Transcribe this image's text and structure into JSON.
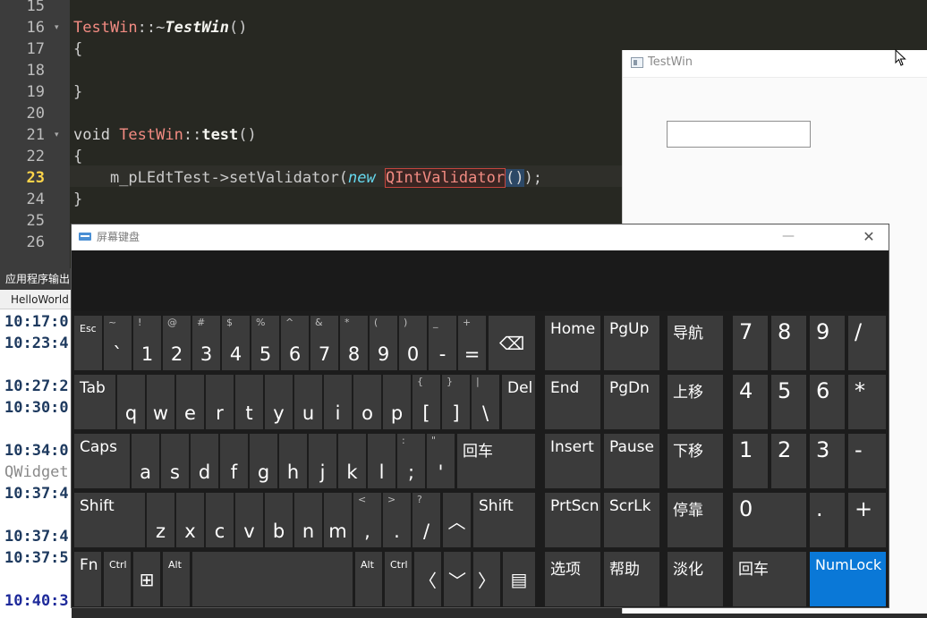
{
  "editor": {
    "lines": [
      {
        "num": "15"
      },
      {
        "num": "16",
        "fold": "▾",
        "parts": [
          {
            "t": "TestWin",
            "c": "cls"
          },
          {
            "t": "::~",
            "c": "op"
          },
          {
            "t": "TestWin",
            "c": "fnb"
          },
          {
            "t": "()",
            "c": "op"
          }
        ]
      },
      {
        "num": "17",
        "parts": [
          {
            "t": "{",
            "c": "op"
          }
        ]
      },
      {
        "num": "18"
      },
      {
        "num": "19",
        "parts": [
          {
            "t": "}",
            "c": "op"
          }
        ]
      },
      {
        "num": "20"
      },
      {
        "num": "21",
        "fold": "▾",
        "parts": [
          {
            "t": "void ",
            "c": "kw"
          },
          {
            "t": "TestWin",
            "c": "cls"
          },
          {
            "t": "::",
            "c": "op"
          },
          {
            "t": "test",
            "c": "fn"
          },
          {
            "t": "()",
            "c": "op"
          }
        ]
      },
      {
        "num": "22",
        "parts": [
          {
            "t": "{",
            "c": "op"
          }
        ]
      },
      {
        "num": "23",
        "current": true,
        "parts": [
          {
            "t": "    m_pLEdtTest->setValidator(",
            "c": "op"
          },
          {
            "t": "new",
            "c": "new"
          },
          {
            "t": " ",
            "c": "op"
          },
          {
            "t": "QIntValidator",
            "c": "hl"
          },
          {
            "t": "()",
            "c": "hlp"
          },
          {
            "t": ");",
            "c": "op"
          }
        ]
      },
      {
        "num": "24",
        "parts": [
          {
            "t": "}",
            "c": "op"
          }
        ]
      },
      {
        "num": "25"
      },
      {
        "num": "26"
      }
    ]
  },
  "output": {
    "header": "应用程序输出",
    "tab": "HelloWorld",
    "lines": [
      {
        "text": "10:17:0",
        "style": ""
      },
      {
        "text": "10:23:4",
        "style": ""
      },
      {
        "text": "10:27:2",
        "style": ""
      },
      {
        "text": "10:30:0",
        "style": ""
      },
      {
        "text": "10:34:0",
        "style": ""
      },
      {
        "text": "QWidget",
        "style": "gray"
      },
      {
        "text": "10:37:4",
        "style": ""
      },
      {
        "text": "10:37:4",
        "style": ""
      },
      {
        "text": "10:37:5",
        "style": ""
      },
      {
        "text": "10:40:3",
        "style": "blue"
      }
    ]
  },
  "testwin": {
    "title": "TestWin",
    "line_edit_value": ""
  },
  "osk": {
    "title": "屏幕键盘",
    "minimize_glyph": "—",
    "close_glyph": "✕",
    "keys": [
      {
        "name": "esc",
        "sm": "Esc"
      },
      {
        "name": "backtick",
        "sh": "~",
        "m": "`"
      },
      {
        "name": "1",
        "sh": "!",
        "m": "1"
      },
      {
        "name": "2",
        "sh": "@",
        "m": "2"
      },
      {
        "name": "3",
        "sh": "#",
        "m": "3"
      },
      {
        "name": "4",
        "sh": "$",
        "m": "4"
      },
      {
        "name": "5",
        "sh": "%",
        "m": "5"
      },
      {
        "name": "6",
        "sh": "^",
        "m": "6"
      },
      {
        "name": "7",
        "sh": "&",
        "m": "7"
      },
      {
        "name": "8",
        "sh": "*",
        "m": "8"
      },
      {
        "name": "9",
        "sh": "(",
        "m": "9"
      },
      {
        "name": "0",
        "sh": ")",
        "m": "0"
      },
      {
        "name": "minus",
        "sh": "_",
        "m": "-"
      },
      {
        "name": "equals",
        "sh": "+",
        "m": "="
      },
      {
        "name": "backspace",
        "icon": "backspace-icon",
        "glyph": "⌫"
      },
      {
        "name": "home",
        "tl": "Home"
      },
      {
        "name": "pgup",
        "tl": "PgUp"
      },
      {
        "name": "nav",
        "tl": "导航"
      },
      {
        "name": "np7",
        "tl": "7",
        "np": true
      },
      {
        "name": "np8",
        "tl": "8",
        "np": true
      },
      {
        "name": "np9",
        "tl": "9",
        "np": true
      },
      {
        "name": "npdiv",
        "tl": "/",
        "np": true
      },
      {
        "name": "tab",
        "tl": "Tab"
      },
      {
        "name": "q",
        "m": "q"
      },
      {
        "name": "w",
        "m": "w"
      },
      {
        "name": "e",
        "m": "e"
      },
      {
        "name": "r",
        "m": "r"
      },
      {
        "name": "t",
        "m": "t"
      },
      {
        "name": "y",
        "m": "y"
      },
      {
        "name": "u",
        "m": "u"
      },
      {
        "name": "i",
        "m": "i"
      },
      {
        "name": "o",
        "m": "o"
      },
      {
        "name": "p",
        "m": "p"
      },
      {
        "name": "lbracket",
        "sh": "{",
        "m": "["
      },
      {
        "name": "rbracket",
        "sh": "}",
        "m": "]"
      },
      {
        "name": "backslash",
        "sh": "|",
        "m": "\\"
      },
      {
        "name": "del",
        "tl": "Del"
      },
      {
        "name": "end",
        "tl": "End"
      },
      {
        "name": "pgdn",
        "tl": "PgDn"
      },
      {
        "name": "moveup",
        "tl": "上移"
      },
      {
        "name": "np4",
        "tl": "4",
        "np": true
      },
      {
        "name": "np5",
        "tl": "5",
        "np": true
      },
      {
        "name": "np6",
        "tl": "6",
        "np": true
      },
      {
        "name": "npmul",
        "tl": "*",
        "np": true
      },
      {
        "name": "caps",
        "tl": "Caps"
      },
      {
        "name": "a",
        "m": "a"
      },
      {
        "name": "s",
        "m": "s"
      },
      {
        "name": "d",
        "m": "d"
      },
      {
        "name": "f",
        "m": "f"
      },
      {
        "name": "g",
        "m": "g"
      },
      {
        "name": "h",
        "m": "h"
      },
      {
        "name": "j",
        "m": "j"
      },
      {
        "name": "k",
        "m": "k"
      },
      {
        "name": "l",
        "m": "l"
      },
      {
        "name": "semicolon",
        "sh": ":",
        "m": ";"
      },
      {
        "name": "quote",
        "sh": "\"",
        "m": "'"
      },
      {
        "name": "enter",
        "tl": "回车"
      },
      {
        "name": "insert",
        "tl": "Insert"
      },
      {
        "name": "pause",
        "tl": "Pause"
      },
      {
        "name": "movedown",
        "tl": "下移"
      },
      {
        "name": "np1",
        "tl": "1",
        "np": true
      },
      {
        "name": "np2",
        "tl": "2",
        "np": true
      },
      {
        "name": "np3",
        "tl": "3",
        "np": true
      },
      {
        "name": "npminus",
        "tl": "-",
        "np": true
      },
      {
        "name": "lshift",
        "tl": "Shift"
      },
      {
        "name": "z",
        "m": "z"
      },
      {
        "name": "x",
        "m": "x"
      },
      {
        "name": "c",
        "m": "c"
      },
      {
        "name": "v",
        "m": "v"
      },
      {
        "name": "b",
        "m": "b"
      },
      {
        "name": "n",
        "m": "n"
      },
      {
        "name": "m",
        "m": "m"
      },
      {
        "name": "comma",
        "sh": "<",
        "m": ","
      },
      {
        "name": "period",
        "sh": ">",
        "m": "."
      },
      {
        "name": "slash",
        "sh": "?",
        "m": "/"
      },
      {
        "name": "uparrow",
        "icon": "arrow-up-icon",
        "glyph": "︿"
      },
      {
        "name": "rshift",
        "tl": "Shift"
      },
      {
        "name": "prtscn",
        "tl": "PrtScn"
      },
      {
        "name": "scrlk",
        "tl": "ScrLk"
      },
      {
        "name": "dock",
        "tl": "停靠"
      },
      {
        "name": "np0",
        "tl": "0",
        "np": true
      },
      {
        "name": "npdot",
        "tl": ".",
        "np": true
      },
      {
        "name": "npplus",
        "tl": "+",
        "np": true
      },
      {
        "name": "fn",
        "tl": "Fn"
      },
      {
        "name": "lctrl",
        "sm": "Ctrl"
      },
      {
        "name": "win",
        "icon": "windows-logo-icon",
        "glyph": "⊞"
      },
      {
        "name": "lalt",
        "sm": "Alt"
      },
      {
        "name": "space"
      },
      {
        "name": "ralt",
        "sm": "Alt"
      },
      {
        "name": "rctrl",
        "sm": "Ctrl"
      },
      {
        "name": "leftarrow",
        "icon": "arrow-left-icon",
        "glyph": "〈"
      },
      {
        "name": "downarrow",
        "icon": "arrow-down-icon",
        "glyph": "﹀"
      },
      {
        "name": "rightarrow",
        "icon": "arrow-right-icon",
        "glyph": "〉"
      },
      {
        "name": "menu",
        "icon": "context-menu-icon",
        "glyph": "▤"
      },
      {
        "name": "options",
        "tl": "选项"
      },
      {
        "name": "help",
        "tl": "帮助"
      },
      {
        "name": "fade",
        "tl": "淡化"
      },
      {
        "name": "npenter",
        "tl": "回车"
      },
      {
        "name": "numlock",
        "tl": "NumLock",
        "active": true
      }
    ]
  },
  "colors": {
    "editor_bg": "#272822",
    "gutter_bg": "#3c3c3c",
    "key_bg": "#3b3b3b",
    "numlock_active": "#0a78d7"
  }
}
